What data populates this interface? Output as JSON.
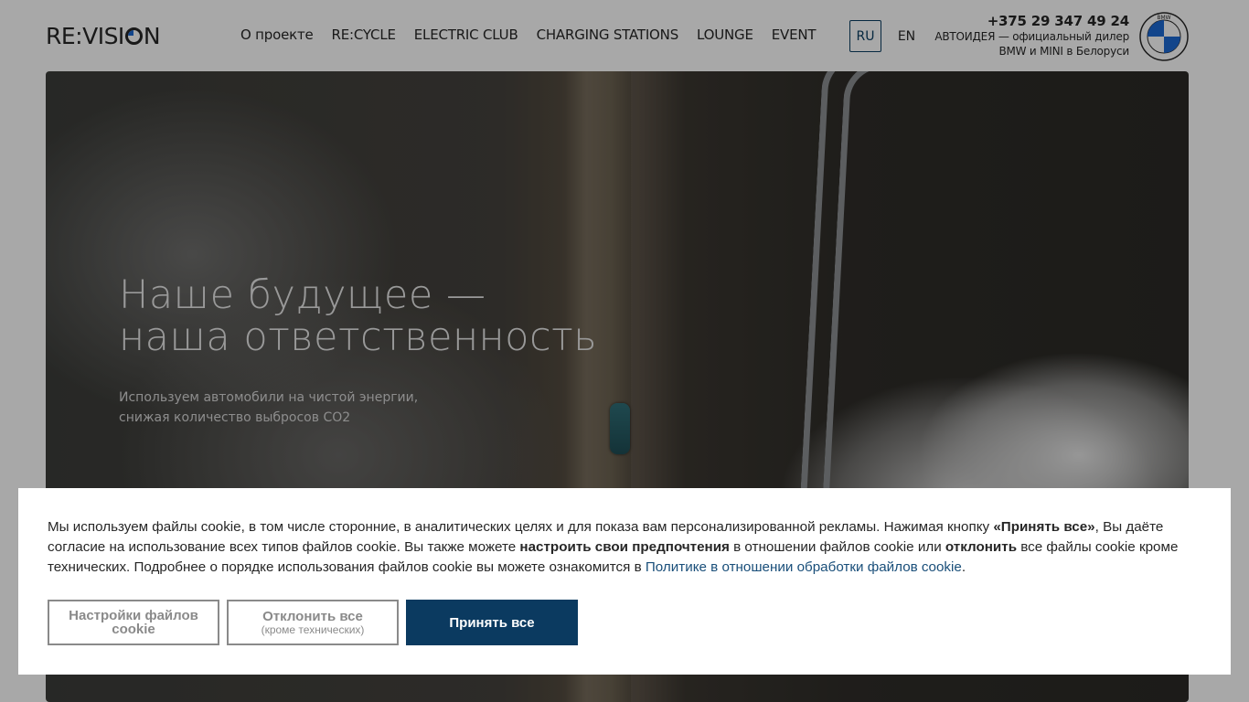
{
  "header": {
    "logo_text_left": "RE:VISI",
    "logo_text_right": "N",
    "nav": [
      {
        "label": "О проекте"
      },
      {
        "label": "RE:CYCLE"
      },
      {
        "label": "ELECTRIC CLUB"
      },
      {
        "label": "CHARGING STATIONS"
      },
      {
        "label": "LOUNGE"
      },
      {
        "label": "EVENT"
      }
    ],
    "lang": {
      "ru": "RU",
      "en": "EN",
      "active": "RU"
    },
    "dealer": {
      "phone": "+375 29 347 49 24",
      "line1": "АВТОИДЕЯ — официальный дилер",
      "line2": "BMW и MINI в Белоруси"
    },
    "brand_logo_text": "BMW"
  },
  "hero": {
    "title_line1": "Наше будущее —",
    "title_line2": "наша ответственность",
    "subtitle_line1": "Используем автомобили на чистой энергии,",
    "subtitle_line2": "снижая количество выбросов CO2"
  },
  "cookie": {
    "t1": "Мы используем файлы cookie, в том числе сторонние, в аналитических целях и для показа вам персонализированной рекламы. Нажимая кнопку ",
    "b1": "«Принять все»",
    "t2": ", Вы даёте согласие на использование всех типов файлов cookie. Вы также можете ",
    "b2": "настроить свои предпочтения",
    "t3": " в отношении файлов cookie или ",
    "b3": "отклонить",
    "t4": " все файлы cookie кроме технических. Подробнее о порядке использования файлов cookie вы можете ознакомится в ",
    "link": "Политике в отношении обработки файлов cookie",
    "t5": ".",
    "settings_label": "Настройки файлов cookie",
    "reject_label": "Отклонить все",
    "reject_sub": "(кроме технических)",
    "accept_label": "Принять все"
  },
  "colors": {
    "accent": "#0b3a60",
    "link": "#1a4f7a",
    "bmw_blue": "#1c69d4"
  }
}
